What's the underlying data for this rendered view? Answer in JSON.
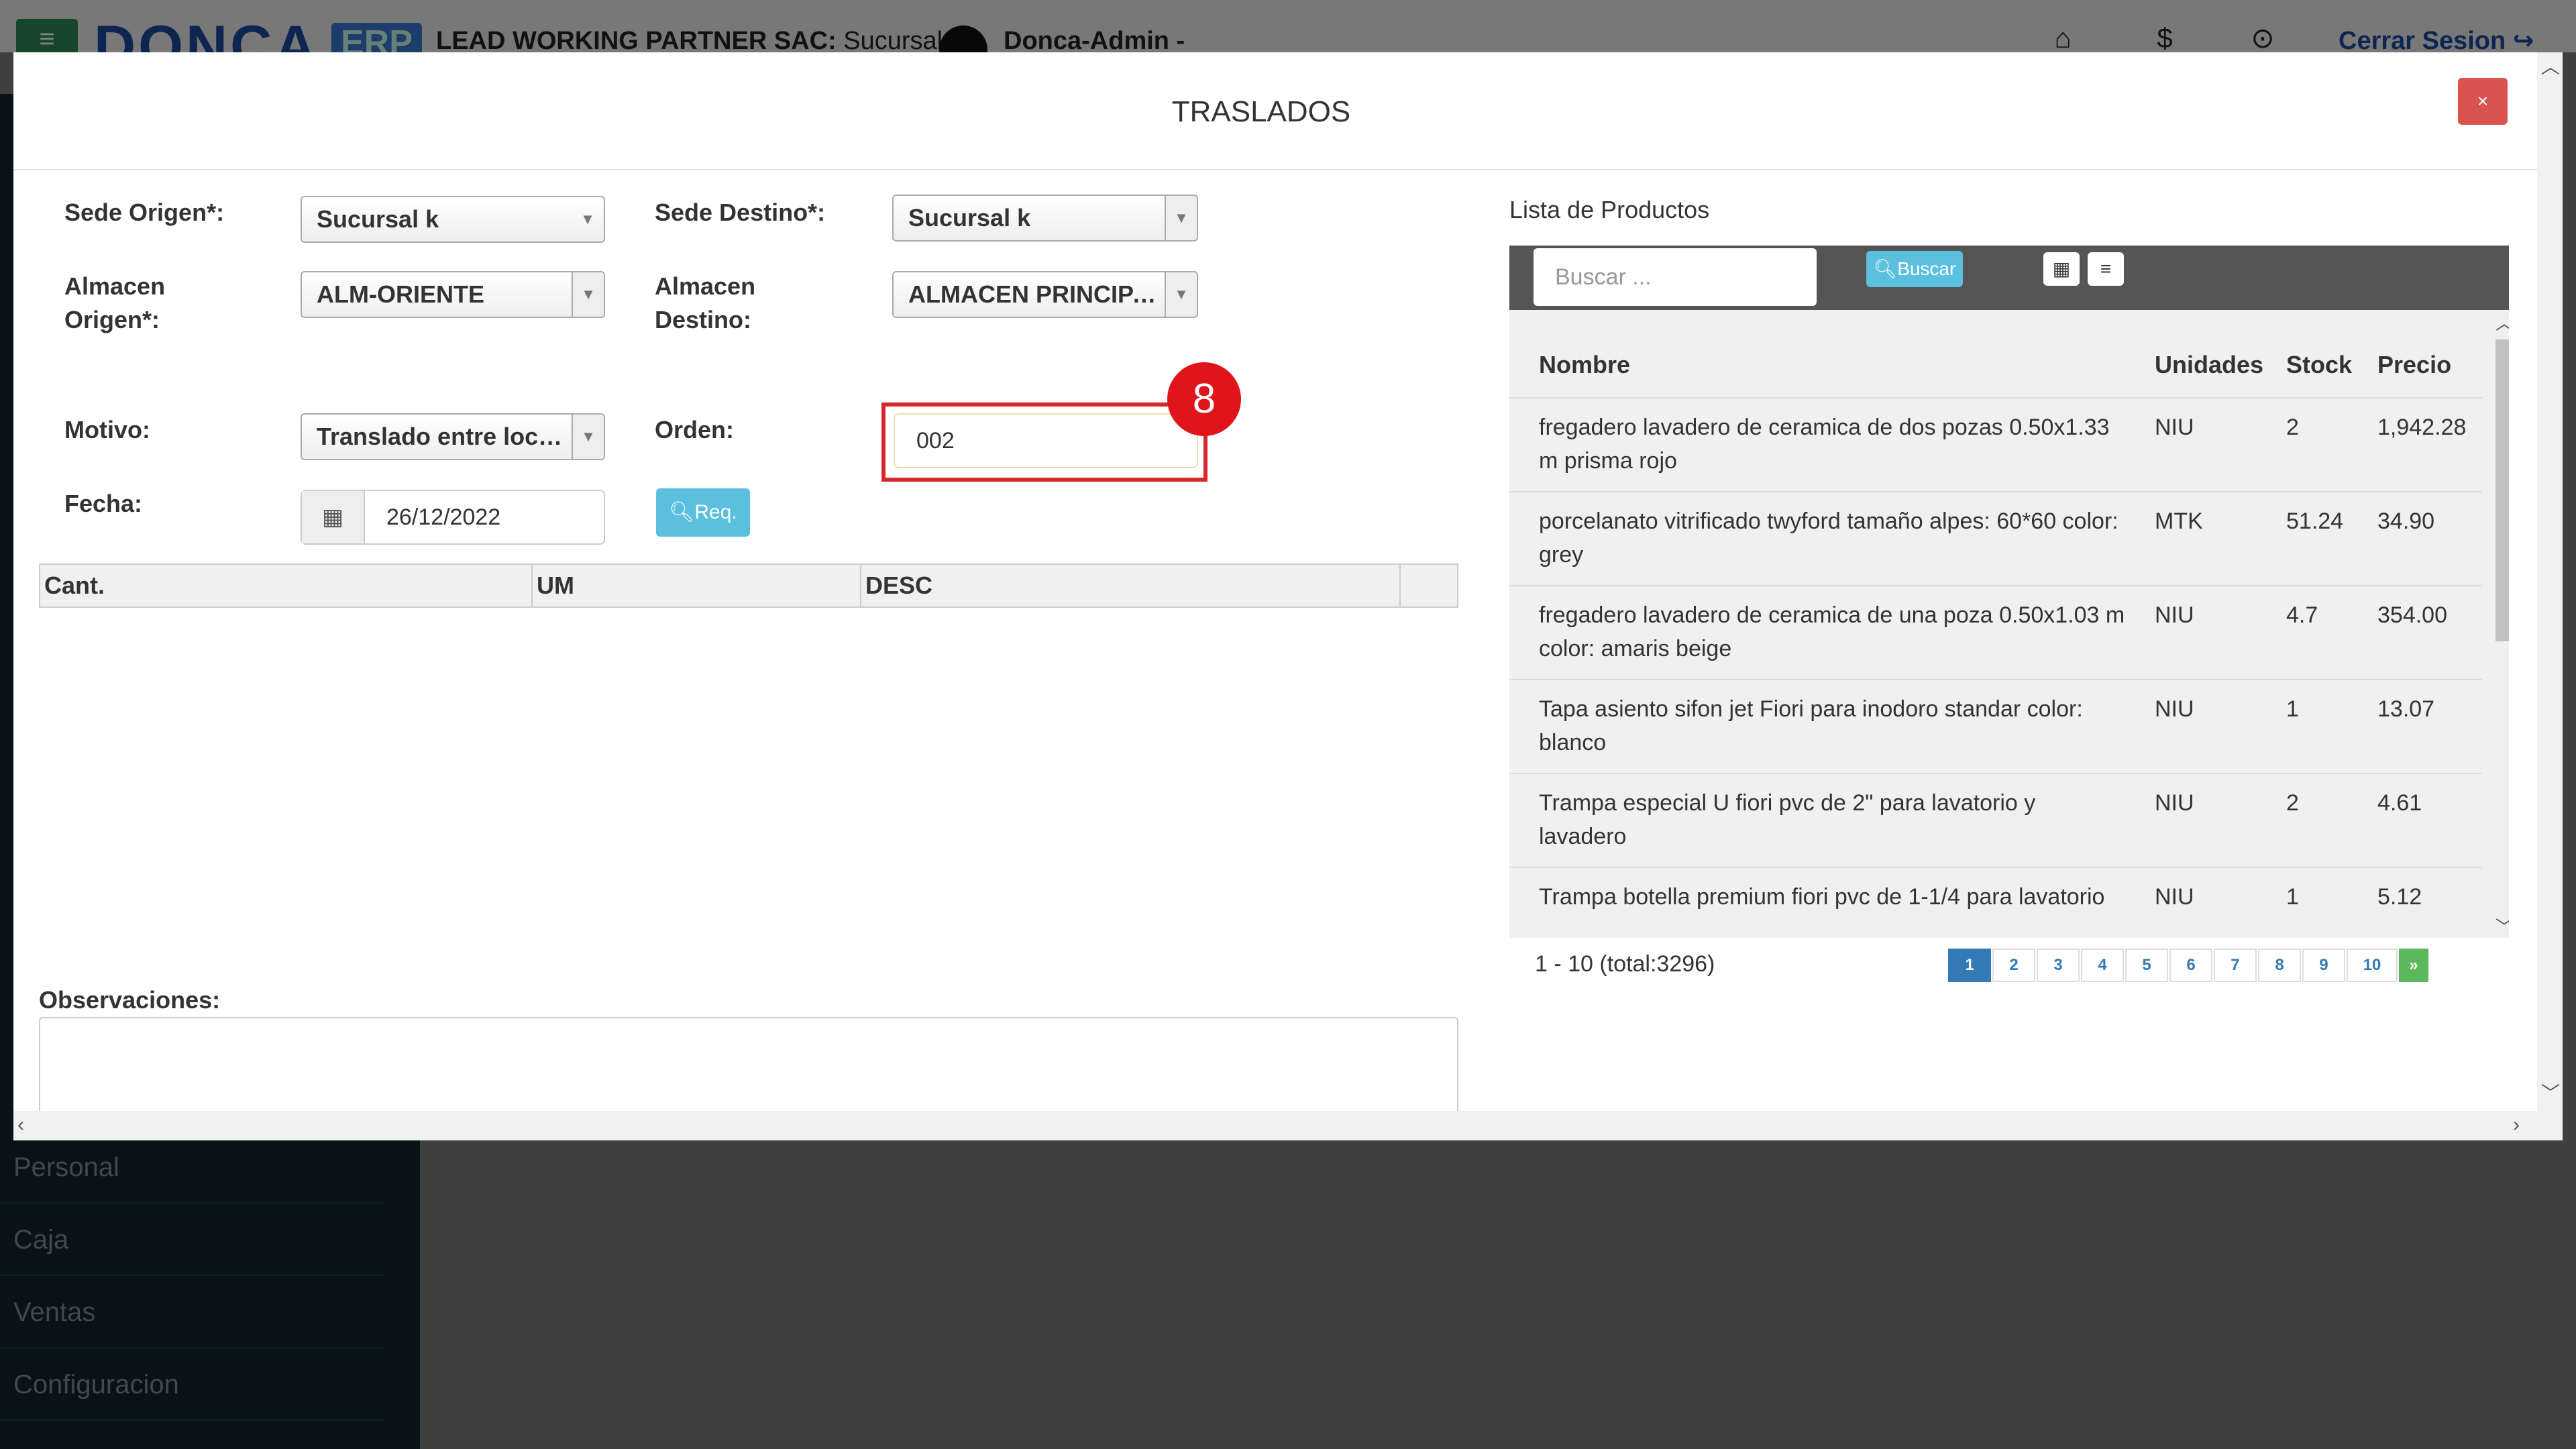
{
  "background_app": {
    "logo_text": "DONCA",
    "logo_badge": "ERP",
    "company_name": "LEAD WORKING PARTNER SAC:",
    "company_branch": "Sucursal k |",
    "user_name": "Donca-Admin -",
    "logout_label": "Cerrar Sesion",
    "sidebar_items": [
      "Personal",
      "Caja",
      "Ventas",
      "Configuracion"
    ]
  },
  "modal": {
    "title": "TRASLADOS",
    "close_label": "×"
  },
  "form": {
    "sede_origen_label": "Sede Origen*:",
    "sede_origen_value": "Sucursal k",
    "sede_destino_label": "Sede Destino*:",
    "sede_destino_value": "Sucursal k",
    "almacen_origen_label_1": "Almacen",
    "almacen_origen_label_2": "Origen*:",
    "almacen_origen_value": "ALM-ORIENTE",
    "almacen_destino_label_1": "Almacen",
    "almacen_destino_label_2": "Destino:",
    "almacen_destino_value": "ALMACEN PRINCIPAL",
    "motivo_label": "Motivo:",
    "motivo_value": "Translado entre locales",
    "orden_label": "Orden:",
    "orden_value": "002",
    "fecha_label": "Fecha:",
    "fecha_value": "26/12/2022",
    "req_button": "Req.",
    "step_badge": "8",
    "observaciones_label": "Observaciones:"
  },
  "detail_grid": {
    "columns": [
      "Cant.",
      "UM",
      "DESC"
    ]
  },
  "products": {
    "title": "Lista de Productos",
    "search_placeholder": "Buscar ...",
    "search_button": "Buscar",
    "columns": [
      "Nombre",
      "Unidades",
      "Stock",
      "Precio"
    ],
    "rows": [
      {
        "nombre_1": "fregadero lavadero de ceramica de dos pozas 0.50x1.33",
        "nombre_2": "m prisma rojo",
        "unidades": "NIU",
        "stock": "2",
        "precio": "1,942.28"
      },
      {
        "nombre_1": "porcelanato vitrificado twyford tamaño alpes: 60*60 color:",
        "nombre_2": "grey",
        "unidades": "MTK",
        "stock": "51.24",
        "precio": "34.90"
      },
      {
        "nombre_1": "fregadero lavadero de ceramica de una poza 0.50x1.03 m",
        "nombre_2": "color: amaris beige",
        "unidades": "NIU",
        "stock": "4.7",
        "precio": "354.00"
      },
      {
        "nombre_1": "Tapa asiento sifon jet Fiori para inodoro standar color:",
        "nombre_2": "blanco",
        "unidades": "NIU",
        "stock": "1",
        "precio": "13.07"
      },
      {
        "nombre_1": "Trampa especial U fiori pvc de 2\" para lavatorio y",
        "nombre_2": "lavadero",
        "unidades": "NIU",
        "stock": "2",
        "precio": "4.61"
      },
      {
        "nombre_1": "Trampa botella premium fiori pvc de 1-1/4 para lavatorio",
        "nombre_2": "",
        "unidades": "NIU",
        "stock": "1",
        "precio": "5.12"
      }
    ],
    "page_info": "1 - 10 (total:3296)",
    "pages": [
      "1",
      "2",
      "3",
      "4",
      "5",
      "6",
      "7",
      "8",
      "9",
      "10"
    ],
    "next_label": "»",
    "active_page": "1"
  },
  "colors": {
    "close": "#d9534f",
    "info": "#5bc0de",
    "highlight": "#d7272a",
    "badge": "#e0141b",
    "page_active": "#337ab7",
    "page_next": "#5cb85c"
  }
}
